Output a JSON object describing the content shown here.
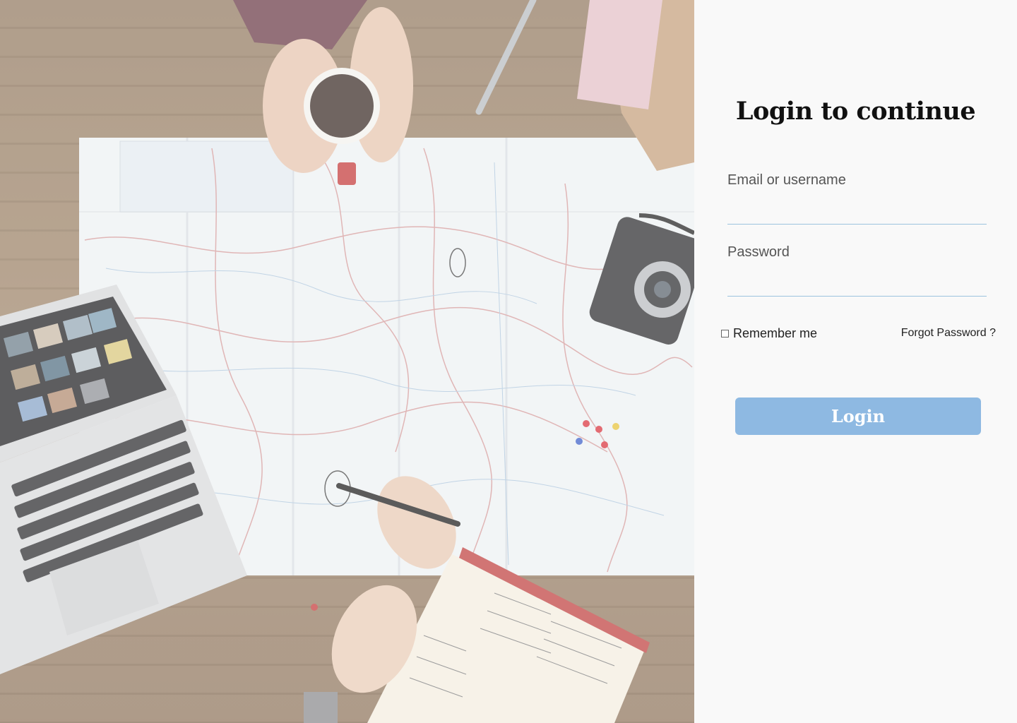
{
  "login": {
    "title": "Login to continue",
    "email_label": "Email or username",
    "email_value": "",
    "password_label": "Password",
    "password_value": "",
    "remember_label": "Remember me",
    "forgot_label": "Forgot Password ?",
    "button_label": "Login"
  },
  "colors": {
    "button": "#8eb9e2",
    "field_underline": "#9cc3de",
    "panel_background": "#f9f9f9"
  },
  "hero_image": {
    "icon": "travel-planning-photo"
  }
}
